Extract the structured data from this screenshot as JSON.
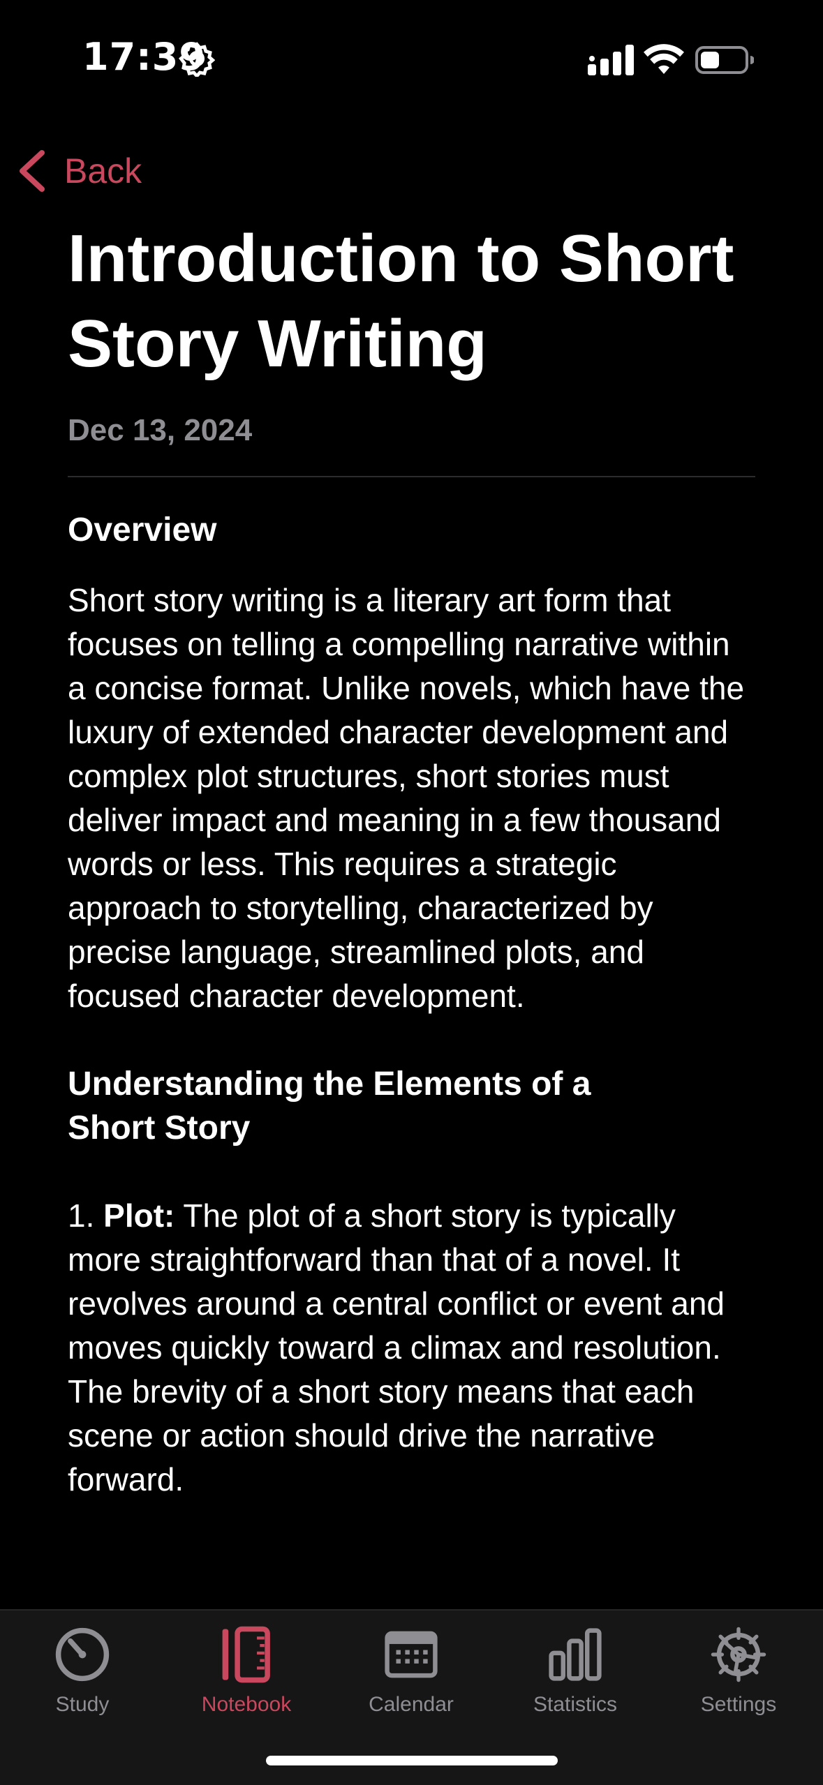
{
  "status_bar": {
    "time": "17:39",
    "icons": [
      "gear-icon",
      "cellular-signal-icon",
      "wifi-icon",
      "battery-icon"
    ]
  },
  "nav": {
    "back_label": "Back",
    "accent_color": "#c9485e"
  },
  "note": {
    "title": "Introduction to Short Story Writing",
    "date": "Dec 13, 2024",
    "sections": {
      "overview_heading": "Overview",
      "overview_text": "Short story writing is a literary art form that focuses on telling a compelling narrative within a concise format. Unlike novels, which have the luxury of extended character development and complex plot structures, short stories must deliver impact and meaning in a few thousand words or less. This requires a strategic approach to storytelling, characterized by precise language, streamlined plots, and focused character development.",
      "elements_heading": "Understanding the Elements of a Short Story",
      "plot_number": "1.",
      "plot_label": "Plot:",
      "plot_text": "The plot of a short story is typically more straightforward than that of a novel. It revolves around a central conflict or event and moves quickly toward a climax and resolution. The brevity of a short story means that each scene or action should drive the narrative forward."
    }
  },
  "tab_bar": {
    "tabs": [
      {
        "label": "Study",
        "icon": "timer-icon",
        "active": false
      },
      {
        "label": "Notebook",
        "icon": "notebook-ruler-icon",
        "active": true
      },
      {
        "label": "Calendar",
        "icon": "calendar-icon",
        "active": false
      },
      {
        "label": "Statistics",
        "icon": "bar-chart-icon",
        "active": false
      },
      {
        "label": "Settings",
        "icon": "gear-icon",
        "active": false
      }
    ]
  }
}
